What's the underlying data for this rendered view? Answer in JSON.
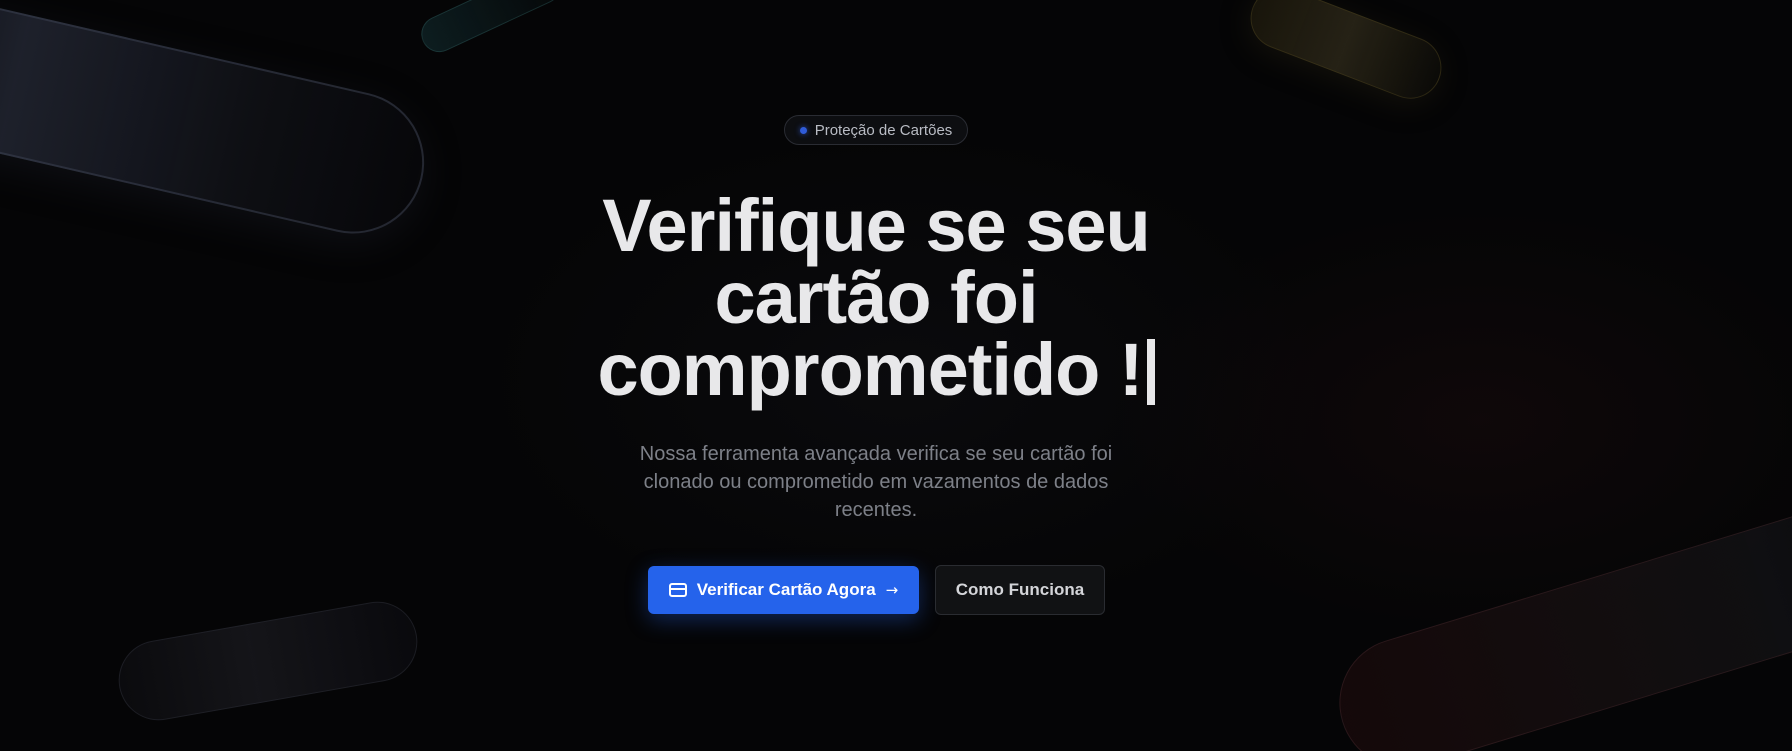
{
  "badge": {
    "label": "Proteção de Cartões",
    "dot_color": "#2f5bd8"
  },
  "hero": {
    "headline_lines": [
      "Verifique se seu",
      "cartão foi",
      "comprometido !"
    ],
    "subtitle": "Nossa ferramenta avançada verifica se seu cartão foi clonado ou comprometido em vazamentos de dados recentes."
  },
  "actions": {
    "primary_label": "Verificar Cartão Agora",
    "primary_icon": "credit-card-icon",
    "primary_trailing_icon": "arrow-right-icon",
    "secondary_label": "Como Funciona"
  },
  "colors": {
    "background": "#050506",
    "primary": "#2563eb",
    "headline": "#e8e8ea",
    "subtitle": "#7d8088"
  }
}
